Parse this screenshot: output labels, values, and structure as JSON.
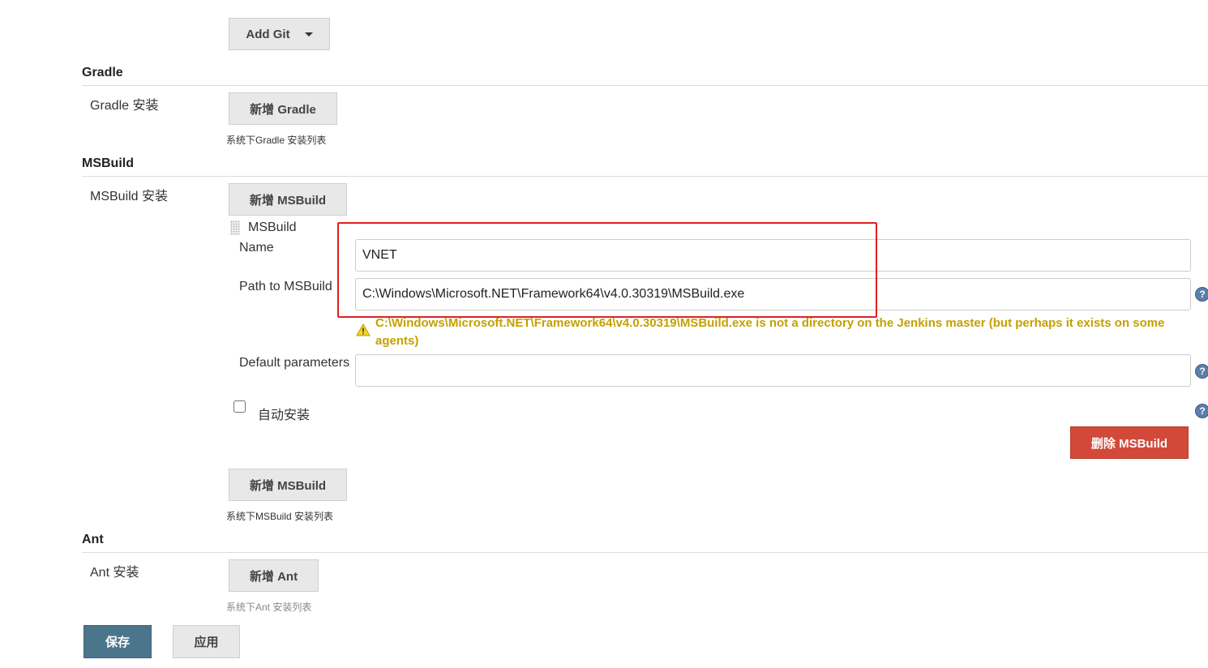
{
  "git": {
    "add_label": "Add Git"
  },
  "gradle": {
    "title": "Gradle",
    "install_label": "Gradle 安装",
    "add_label": "新增 Gradle",
    "hint": "系统下Gradle 安装列表"
  },
  "msbuild": {
    "title": "MSBuild",
    "install_label": "MSBuild 安装",
    "add_label_top": "新增 MSBuild",
    "item_title": "MSBuild",
    "name_label": "Name",
    "name_value": "VNET",
    "path_label": "Path to MSBuild",
    "path_value": "C:\\Windows\\Microsoft.NET\\Framework64\\v4.0.30319\\MSBuild.exe",
    "warning": "C:\\Windows\\Microsoft.NET\\Framework64\\v4.0.30319\\MSBuild.exe is not a directory on the Jenkins master (but perhaps it exists on some agents)",
    "default_params_label": "Default parameters",
    "default_params_value": "",
    "auto_install_label": "自动安装",
    "delete_label": "删除 MSBuild",
    "add_label_bottom": "新增 MSBuild",
    "hint": "系统下MSBuild 安装列表"
  },
  "ant": {
    "title": "Ant",
    "install_label": "Ant 安装",
    "add_label": "新增 Ant",
    "hint": "系统下Ant 安装列表"
  },
  "footer": {
    "save_label": "保存",
    "apply_label": "应用"
  },
  "colors": {
    "save_button": "#4b758b",
    "delete_button": "#d24939",
    "warning_text": "#c4a000",
    "highlight_box": "#e02020"
  }
}
